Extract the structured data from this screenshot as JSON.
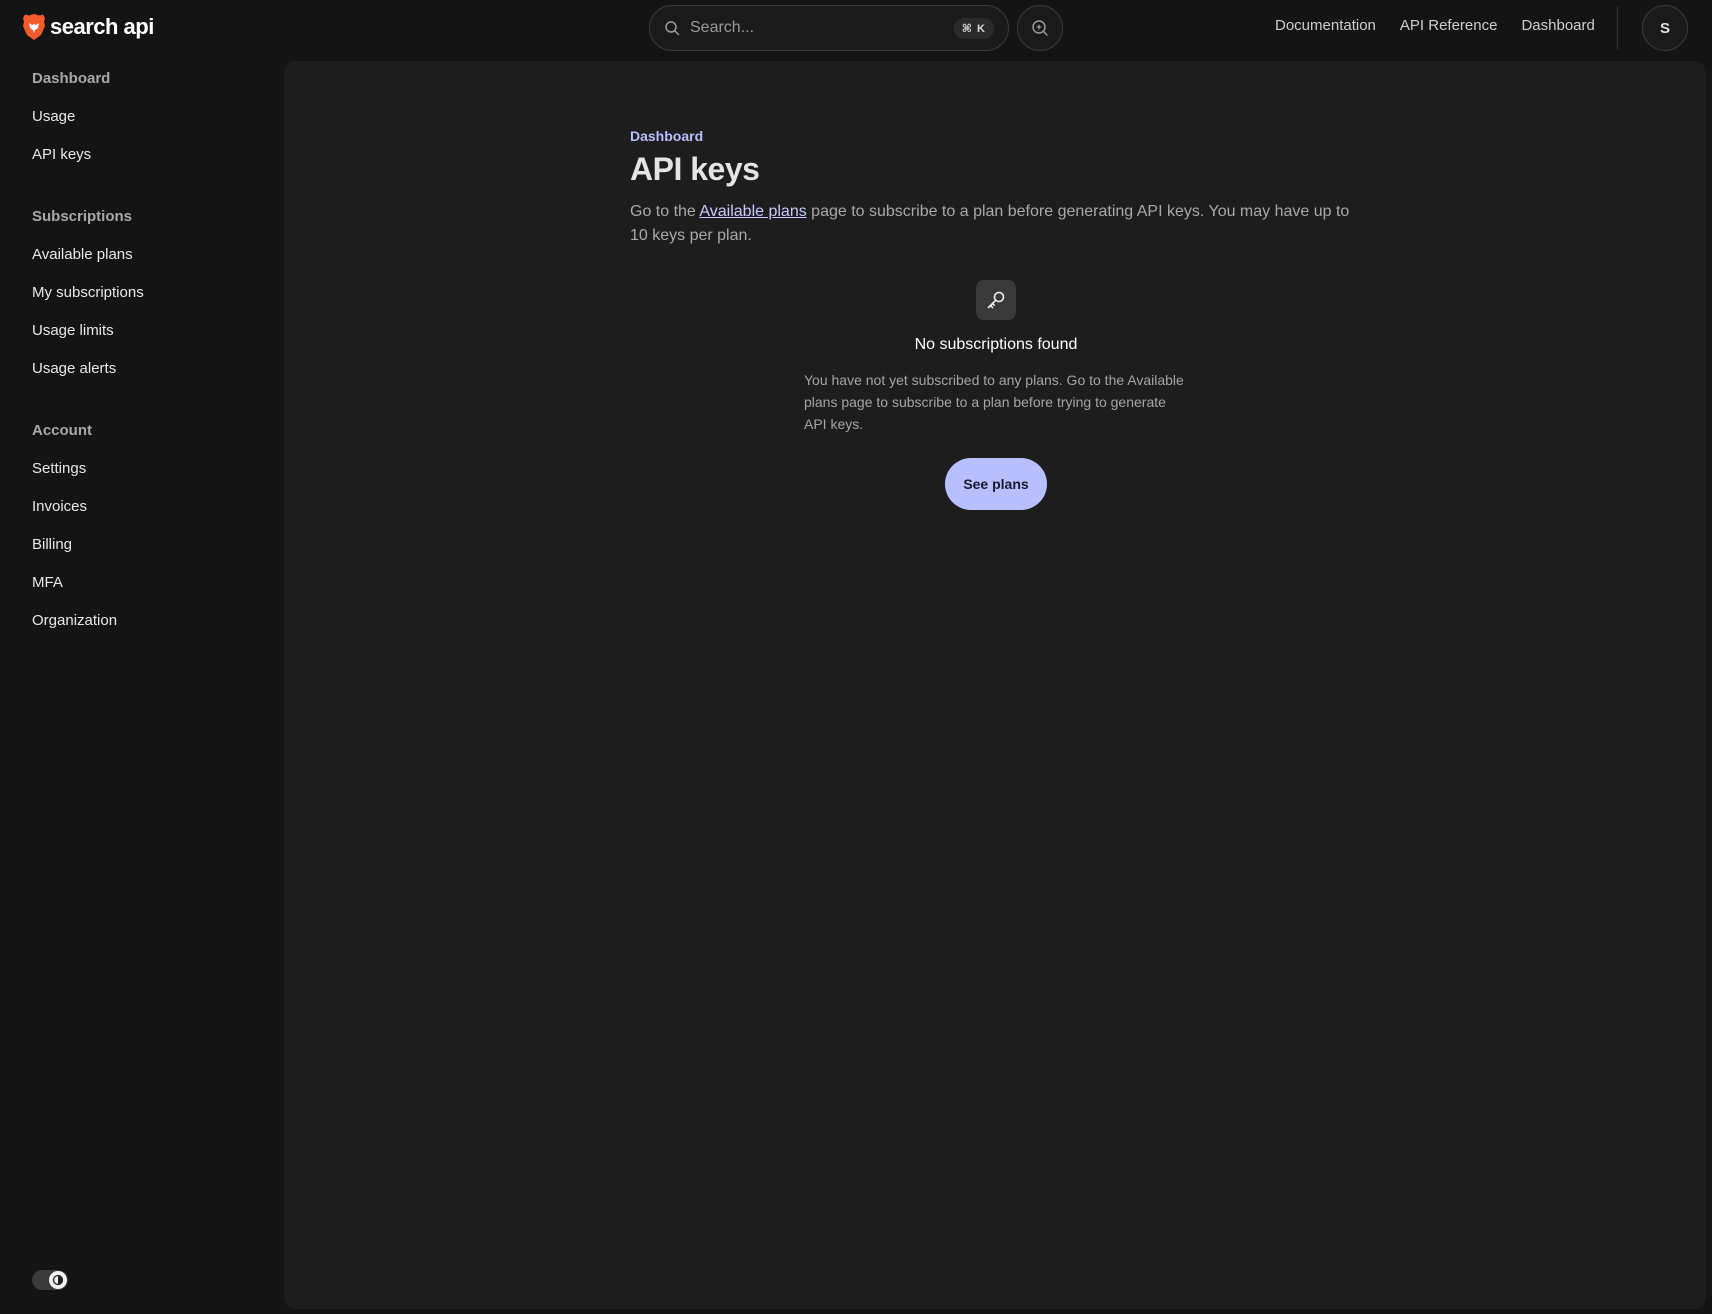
{
  "header": {
    "logo_text": "search api",
    "search": {
      "placeholder": "Search...",
      "shortcut": "⌘ K"
    },
    "links": [
      "Documentation",
      "API Reference",
      "Dashboard"
    ],
    "avatar_initial": "S"
  },
  "sidebar": {
    "sections": [
      {
        "title": "Dashboard",
        "items": [
          "Usage",
          "API keys"
        ]
      },
      {
        "title": "Subscriptions",
        "items": [
          "Available plans",
          "My subscriptions",
          "Usage limits",
          "Usage alerts"
        ]
      },
      {
        "title": "Account",
        "items": [
          "Settings",
          "Invoices",
          "Billing",
          "MFA",
          "Organization"
        ]
      }
    ]
  },
  "main": {
    "breadcrumb": "Dashboard",
    "title": "API keys",
    "intro": {
      "before": "Go to the ",
      "link": "Available plans",
      "after": " page to subscribe to a plan before generating API keys. You may have up to 10 keys per plan."
    },
    "empty_state": {
      "icon": "key-icon",
      "title": "No subscriptions found",
      "text": "You have not yet subscribed to any plans. Go to the Available plans page to subscribe to a plan before trying to generate API keys.",
      "button": "See plans"
    }
  },
  "colors": {
    "accent": "#b8bfff",
    "background": "#141414",
    "panel": "#1d1d1d",
    "brand_orange": "#f25a2b"
  }
}
